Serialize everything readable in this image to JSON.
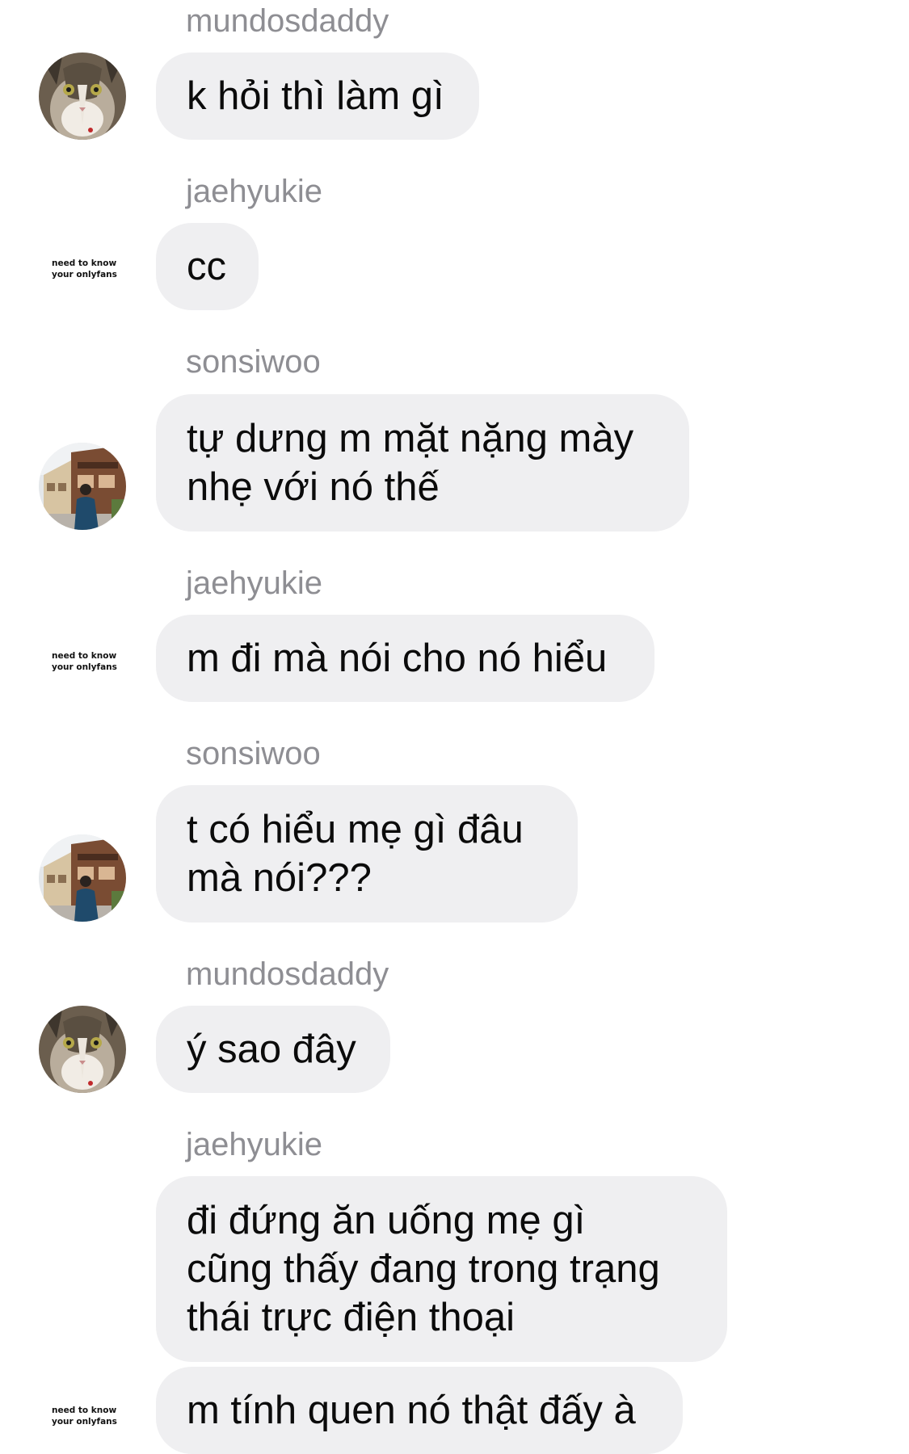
{
  "messages": [
    {
      "sender": "mundosdaddy",
      "text": "k hỏi thì làm gì"
    },
    {
      "sender": "jaehyukie",
      "text": "cc"
    },
    {
      "sender": "sonsiwoo",
      "text_lines": [
        "tự dưng m mặt nặng mày",
        "nhẹ với nó thế"
      ]
    },
    {
      "sender": "jaehyukie",
      "text": "m đi mà nói cho nó hiểu"
    },
    {
      "sender": "sonsiwoo",
      "text_lines": [
        "t có hiểu mẹ gì đâu",
        "mà nói???"
      ]
    },
    {
      "sender": "mundosdaddy",
      "text": "ý sao đây"
    },
    {
      "sender": "jaehyukie",
      "text_lines": [
        "đi đứng ăn uống mẹ gì",
        "cũng thấy đang trong trạng",
        "thái trực điện thoại"
      ]
    },
    {
      "sender": "jaehyukie",
      "text": "m tính quen nó thật đấy à"
    }
  ],
  "avatars": {
    "jaehyukie_caption": [
      "need to know",
      "your onlyfans"
    ]
  }
}
